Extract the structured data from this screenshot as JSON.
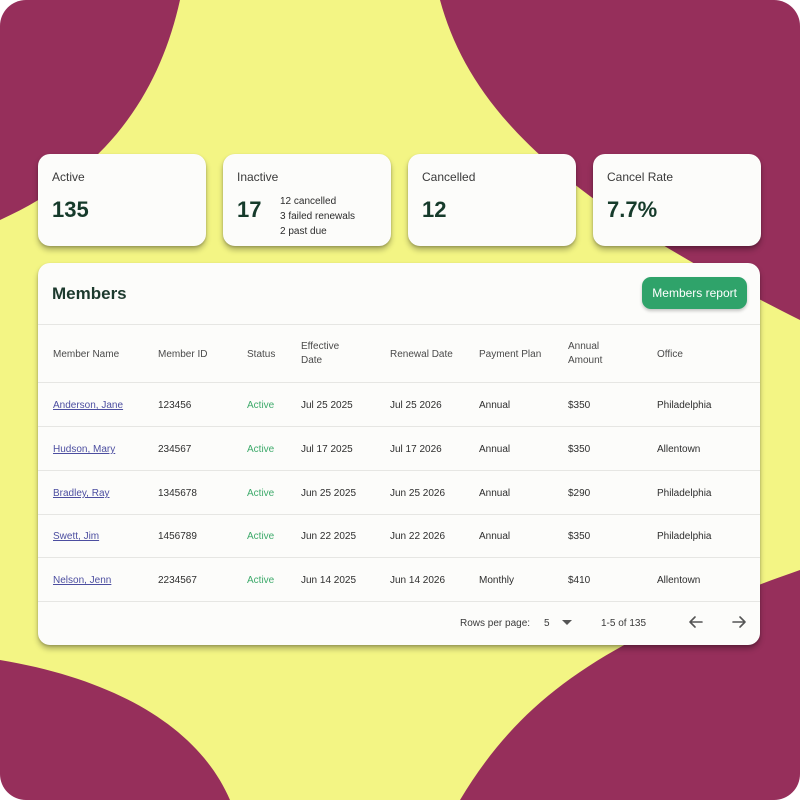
{
  "colors": {
    "background_plum": "#962f5b",
    "background_yellow": "#f3f584",
    "accent_green": "#2fa36a",
    "status_active": "#3eaa6b",
    "link": "#4c4ea0"
  },
  "stats": [
    {
      "label": "Active",
      "value": "135"
    },
    {
      "label": "Inactive",
      "value": "17",
      "breakdown": [
        "12 cancelled",
        "3 failed renewals",
        "2 past due"
      ]
    },
    {
      "label": "Cancelled",
      "value": "12"
    },
    {
      "label": "Cancel Rate",
      "value": "7.7%"
    }
  ],
  "members": {
    "title": "Members",
    "report_button": "Members report",
    "columns": {
      "name": "Member Name",
      "id": "Member ID",
      "status": "Status",
      "effective_l1": "Effective",
      "effective_l2": "Date",
      "renewal": "Renewal Date",
      "plan": "Payment Plan",
      "amount_l1": "Annual",
      "amount_l2": "Amount",
      "office": "Office"
    },
    "rows": [
      {
        "name": "Anderson, Jane",
        "id": "123456",
        "status": "Active",
        "effective": "Jul 25 2025",
        "renewal": "Jul 25 2026",
        "plan": "Annual",
        "amount": "$350",
        "office": "Philadelphia"
      },
      {
        "name": "Hudson, Mary",
        "id": "234567",
        "status": "Active",
        "effective": "Jul 17 2025",
        "renewal": "Jul 17 2026",
        "plan": "Annual",
        "amount": "$350",
        "office": "Allentown"
      },
      {
        "name": "Bradley, Ray",
        "id": "1345678",
        "status": "Active",
        "effective": "Jun 25 2025",
        "renewal": "Jun 25 2026",
        "plan": "Annual",
        "amount": "$290",
        "office": "Philadelphia"
      },
      {
        "name": "Swett, Jim",
        "id": "1456789",
        "status": "Active",
        "effective": "Jun 22 2025",
        "renewal": "Jun 22 2026",
        "plan": "Annual",
        "amount": "$350",
        "office": "Philadelphia"
      },
      {
        "name": "Nelson, Jenn",
        "id": "2234567",
        "status": "Active",
        "effective": "Jun 14 2025",
        "renewal": "Jun 14 2026",
        "plan": "Monthly",
        "amount": "$410",
        "office": "Allentown"
      }
    ],
    "pagination": {
      "rows_per_page_label": "Rows per page:",
      "rows_per_page_value": "5",
      "range": "1-5 of 135",
      "icons": {
        "dropdown": "caret-down-icon",
        "prev": "arrow-left-icon",
        "next": "arrow-right-icon"
      }
    }
  }
}
